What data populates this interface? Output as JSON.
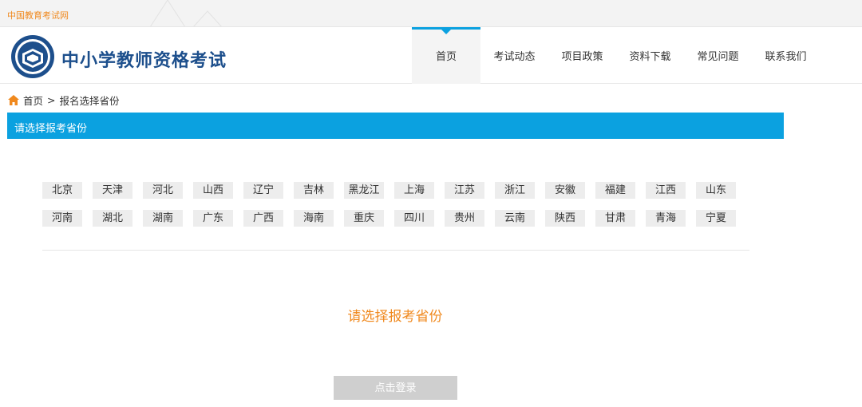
{
  "topbar": {
    "link_text": "中国教育考试网"
  },
  "header": {
    "logo_icon": "teacher-exam-logo-icon",
    "title": "中小学教师资格考试",
    "nav": [
      {
        "label": "首页",
        "active": true
      },
      {
        "label": "考试动态",
        "active": false
      },
      {
        "label": "项目政策",
        "active": false
      },
      {
        "label": "资料下载",
        "active": false
      },
      {
        "label": "常见问题",
        "active": false
      },
      {
        "label": "联系我们",
        "active": false
      }
    ]
  },
  "breadcrumb": {
    "icon": "home-icon",
    "home": "首页",
    "separator": ">",
    "current": "报名选择省份"
  },
  "section": {
    "title": "请选择报考省份"
  },
  "provinces": {
    "row1": [
      "北京",
      "天津",
      "河北",
      "山西",
      "辽宁",
      "吉林",
      "黑龙江",
      "上海",
      "江苏",
      "浙江",
      "安徽",
      "福建",
      "江西",
      "山东"
    ],
    "row2": [
      "河南",
      "湖北",
      "湖南",
      "广东",
      "广西",
      "海南",
      "重庆",
      "四川",
      "贵州",
      "云南",
      "陕西",
      "甘肃",
      "青海",
      "宁夏"
    ]
  },
  "prompt": "请选择报考省份",
  "login_button": "点击登录",
  "colors": {
    "accent": "#0ba1e0",
    "orange": "#f0891e",
    "brand": "#1d4f8c"
  }
}
